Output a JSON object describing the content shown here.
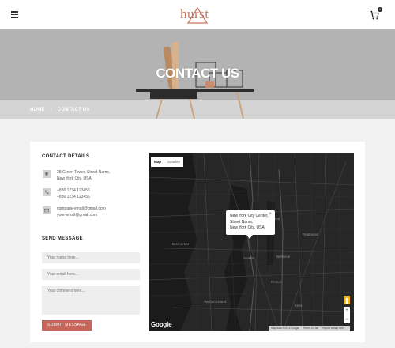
{
  "header": {
    "logo_text": "hurst",
    "menu_icon": "hamburger-icon",
    "cart_icon": "cart-icon",
    "cart_count": "0",
    "accent_color": "#c8755f"
  },
  "hero": {
    "title": "CONTACT US",
    "breadcrumb": {
      "home": "HOME",
      "separator": "/",
      "current": "CONTACT US"
    }
  },
  "contact": {
    "title": "CONTACT DETAILS",
    "address": {
      "icon": "location-pin-icon",
      "line1": "28 Green Tower, Street Name,",
      "line2": "New York City, USA"
    },
    "phone": {
      "icon": "phone-icon",
      "line1": "+880 1234 123456",
      "line2": "+880 1234 123456"
    },
    "email": {
      "icon": "mail-icon",
      "line1": "company-email@gmail.com",
      "line2": "your-email@gmail.com"
    }
  },
  "form": {
    "title": "SEND MESSAGE",
    "name_placeholder": "Your name here...",
    "email_placeholder": "Your email here...",
    "comment_placeholder": "Your comment here...",
    "submit_label": "SUBMIT MESSAGE",
    "submit_color": "#c8655a"
  },
  "map": {
    "type_map": "Map",
    "type_satellite": "Satellite",
    "info_line1": "New York City Center,",
    "info_line2": "Street Name,",
    "info_line3": "New York City, USA",
    "info_close": "×",
    "zoom_in": "+",
    "zoom_out": "−",
    "google_label": "Google",
    "footer_data": "Map data ©2016 Google",
    "footer_terms": "Terms of Use",
    "footer_report": "Report a map error",
    "cities": {
      "redmond": "Redmond",
      "seattle": "Seattle",
      "bellevue": "Bellevue",
      "renton": "Renton",
      "kirkland": "Kirkland",
      "bremerton": "Bremerton",
      "vashon": "Vashon Island",
      "kent": "Kent"
    }
  }
}
